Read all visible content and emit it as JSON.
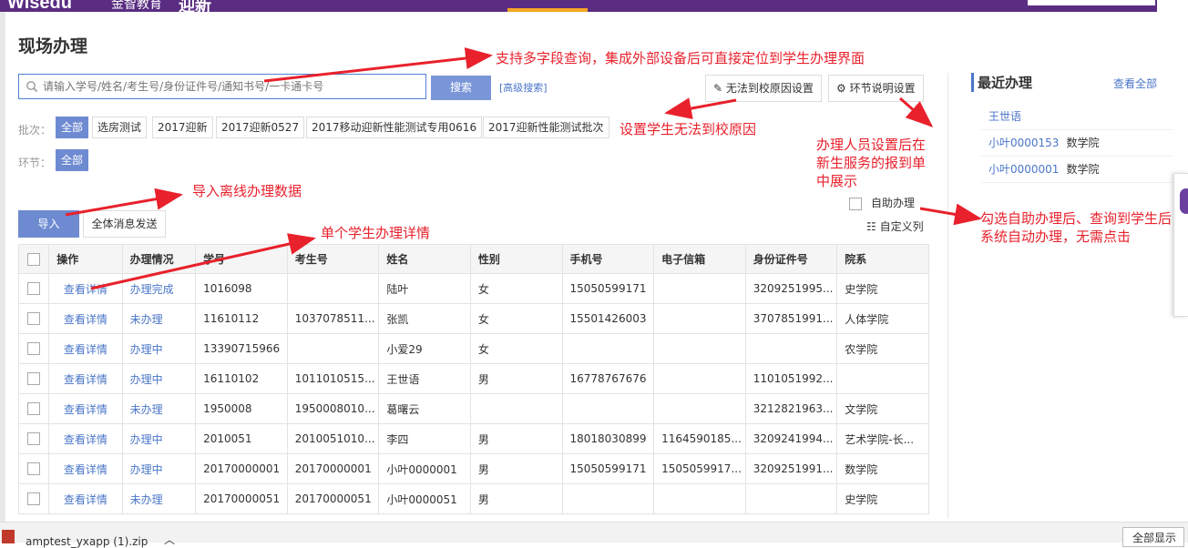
{
  "topbar": {
    "brand": "Wisedu",
    "brand_cn": "金智教育",
    "module": "迎新"
  },
  "page_title": "现场办理",
  "search": {
    "placeholder": "请输入学号/姓名/考生号/身份证件号/通知书号/一卡通卡号",
    "button": "搜索",
    "advanced": "[高级搜索]"
  },
  "actions": {
    "no_arrival": "无法到校原因设置",
    "step_desc": "环节说明设置"
  },
  "filters": {
    "batch_label": "批次：",
    "batches": [
      "全部",
      "选房测试",
      "2017迎新",
      "2017迎新0527",
      "2017移动迎新性能测试专用0616",
      "2017迎新性能测试批次"
    ],
    "step_label": "环节：",
    "steps": [
      "全部"
    ]
  },
  "toolbar": {
    "import": "导入",
    "broadcast": "全体消息发送",
    "self_service": "自助办理",
    "custom_columns": "自定义列"
  },
  "table": {
    "headers": [
      "操作",
      "办理情况",
      "学号",
      "考生号",
      "姓名",
      "性别",
      "手机号",
      "电子信箱",
      "身份证件号",
      "院系"
    ],
    "rows": [
      [
        "查看详情",
        "办理完成",
        "1016098",
        "",
        "陆叶",
        "女",
        "15050599171",
        "",
        "3209251995...",
        "史学院"
      ],
      [
        "查看详情",
        "未办理",
        "11610112",
        "1037078511...",
        "张凯",
        "女",
        "15501426003",
        "",
        "3707851991...",
        "人体学院"
      ],
      [
        "查看详情",
        "办理中",
        "13390715966",
        "",
        "小爱29",
        "女",
        "",
        "",
        "",
        "农学院"
      ],
      [
        "查看详情",
        "办理中",
        "16110102",
        "1011010515...",
        "王世语",
        "男",
        "16778767676",
        "",
        "1101051992...",
        ""
      ],
      [
        "查看详情",
        "未办理",
        "1950008",
        "1950008010...",
        "葛曙云",
        "",
        "",
        "",
        "3212821963...",
        "文学院"
      ],
      [
        "查看详情",
        "办理中",
        "2010051",
        "2010051010...",
        "李四",
        "男",
        "18018030899",
        "1164590185...",
        "3209241994...",
        "艺术学院-长..."
      ],
      [
        "查看详情",
        "办理中",
        "20170000001",
        "20170000001",
        "小叶0000001",
        "男",
        "15050599171",
        "1505059917...",
        "3209251991...",
        "数学院"
      ],
      [
        "查看详情",
        "未办理",
        "20170000051",
        "20170000051",
        "小叶0000051",
        "男",
        "",
        "",
        "",
        "史学院"
      ]
    ]
  },
  "recent": {
    "title": "最近办理",
    "view_all": "查看全部",
    "items": [
      {
        "name": "王世语",
        "dept": ""
      },
      {
        "name": "小叶0000153",
        "dept": "数学院"
      },
      {
        "name": "小叶0000001",
        "dept": "数学院"
      }
    ]
  },
  "annotations": {
    "a1": "支持多字段查询，集成外部设备后可直接定位到学生办理界面",
    "a2": "设置学生无法到校原因",
    "a3_l1": "办理人员设置后在",
    "a3_l2": "新生服务的报到单",
    "a3_l3": "中展示",
    "a4": "导入离线办理数据",
    "a5": "单个学生办理详情",
    "a6_l1": "勾选自助办理后、查询到学生后",
    "a6_l2": "系统自动办理，无需点击"
  },
  "download_bar": {
    "filename": "amptest_yxapp (1).zip",
    "show_all": "全部显示"
  },
  "colors": {
    "primary": "#6e8ad1",
    "topbar": "#5a2d82",
    "annotation": "#e8212c",
    "link": "#4a76c8"
  }
}
